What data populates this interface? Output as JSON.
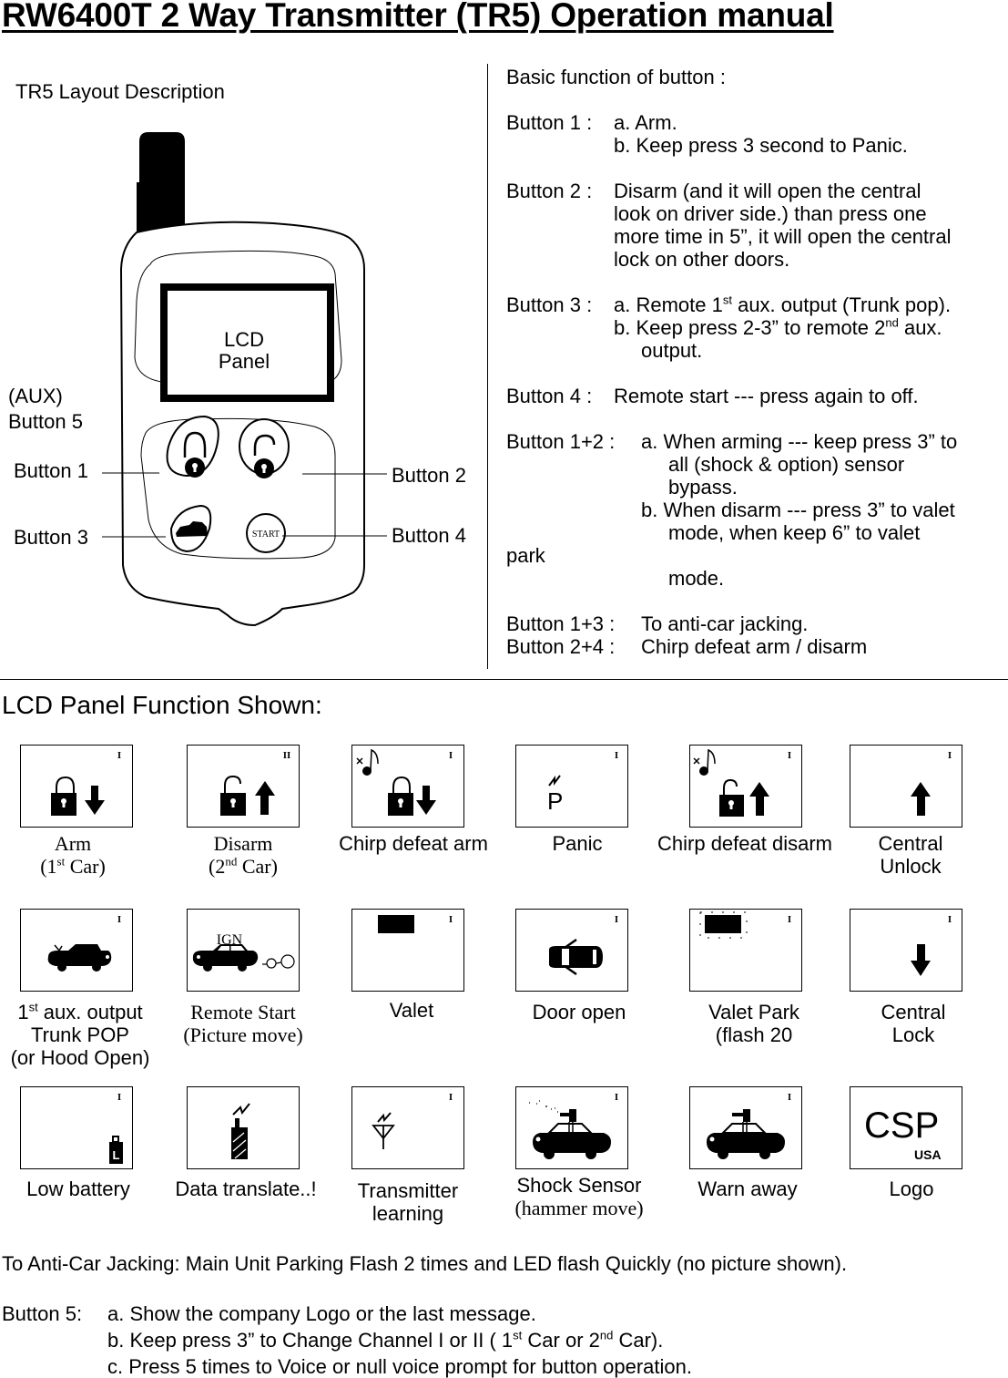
{
  "document": {
    "title": "RW6400T 2 Way Transmitter (TR5) Operation manual"
  },
  "layout": {
    "heading": "TR5 Layout Description",
    "remote": {
      "lcd_label_line1": "LCD",
      "lcd_label_line2": "Panel",
      "start_label": "START",
      "callouts": {
        "aux_line1": "(AUX)",
        "aux_line2": "Button 5",
        "button1": "Button 1",
        "button2": "Button 2",
        "button3": "Button 3",
        "button4": "Button 4"
      }
    }
  },
  "functions": {
    "heading": "Basic function of button :",
    "b1_label": "Button 1 :",
    "b1_a": "a. Arm.",
    "b1_b": "b. Keep press 3 second to Panic.",
    "b2_label": "Button 2 :",
    "b2_l1": "Disarm (and it will open the central",
    "b2_l2": "look on driver side.) than press one",
    "b2_l3": "more time in 5”, it will open the central",
    "b2_l4": "lock on other doors.",
    "b3_label": "Button 3 :",
    "b3_a_pre": "a. Remote 1",
    "b3_a_sup": "st",
    "b3_a_post": " aux. output (Trunk pop).",
    "b3_b_pre": "b. Keep press 2-3” to remote 2",
    "b3_b_sup": "nd",
    "b3_b_post": " aux.",
    "b3_b_l2": "output.",
    "b4_label": "Button 4 :",
    "b4_text": "Remote start --- press again to off.",
    "b12_label": "Button 1+2 :",
    "b12_a1": "a. When arming --- keep press 3” to",
    "b12_a2": "all (shock & option) sensor",
    "b12_a3": "bypass.",
    "b12_b1": "b. When disarm --- press 3” to valet",
    "b12_b2": "mode, when keep 6” to valet",
    "b12_b3": "park",
    "b12_b4": "mode.",
    "b13_label": "Button 1+3 :",
    "b13_text": "To anti-car jacking.",
    "b24_label": "Button 2+4 :",
    "b24_text": "Chirp defeat arm / disarm"
  },
  "lcd_section": {
    "heading": "LCD Panel Function Shown:",
    "channel_mark_1": "I",
    "channel_mark_2": "II",
    "items": [
      {
        "icon": "lock-arm-icon",
        "l1": "Arm",
        "l2_pre": "(1",
        "l2_sup": "st",
        "l2_post": " Car)"
      },
      {
        "icon": "unlock-disarm-icon",
        "l1": "Disarm",
        "l2_pre": "(2",
        "l2_sup": "nd",
        "l2_post": " Car)"
      },
      {
        "icon": "chirp-defeat-arm-icon",
        "l1": "Chirp defeat arm"
      },
      {
        "icon": "panic-icon",
        "l1": "Panic",
        "glyph": "P"
      },
      {
        "icon": "chirp-defeat-disarm-icon",
        "l1": "Chirp defeat disarm"
      },
      {
        "icon": "central-unlock-icon",
        "l1": "Central",
        "l2": "Unlock"
      },
      {
        "icon": "trunk-pop-icon",
        "l1_pre": "1",
        "l1_sup": "st",
        "l1_post": " aux. output",
        "l2": "Trunk POP",
        "l3": "(or Hood Open)"
      },
      {
        "icon": "remote-start-icon",
        "l1": "Remote Start",
        "l2": "(Picture move)",
        "glyph": "IGN"
      },
      {
        "icon": "valet-icon",
        "l1": "Valet"
      },
      {
        "icon": "door-open-icon",
        "l1": "Door open"
      },
      {
        "icon": "valet-park-icon",
        "l1": "Valet Park",
        "l2": "(flash 20"
      },
      {
        "icon": "central-lock-icon",
        "l1": "Central",
        "l2": "Lock"
      },
      {
        "icon": "low-battery-icon",
        "l1": "Low battery",
        "glyph": "L"
      },
      {
        "icon": "data-translate-icon",
        "l1": "Data translate..!"
      },
      {
        "icon": "transmitter-learning-icon",
        "l1": "Transmitter",
        "l2": "learning"
      },
      {
        "icon": "shock-sensor-icon",
        "l1": "Shock Sensor",
        "l2": "(hammer move)"
      },
      {
        "icon": "warn-away-icon",
        "l1": "Warn away"
      },
      {
        "icon": "logo-icon",
        "l1": "Logo",
        "glyph": "CSP",
        "glyph_sub": "USA"
      }
    ]
  },
  "notes": {
    "anti_jacking": "To Anti-Car Jacking: Main Unit Parking Flash 2 times and LED flash Quickly (no picture shown).",
    "b5_label": "Button 5:",
    "b5_a": "a. Show the company Logo or the last message.",
    "b5_b_pre": "b. Keep press 3” to Change Channel I or II ( 1",
    "b5_b_sup1": "st",
    "b5_b_mid": " Car or 2",
    "b5_b_sup2": "nd",
    "b5_b_post": " Car).",
    "b5_c": "c. Press 5 times to Voice or null voice prompt for button operation."
  }
}
